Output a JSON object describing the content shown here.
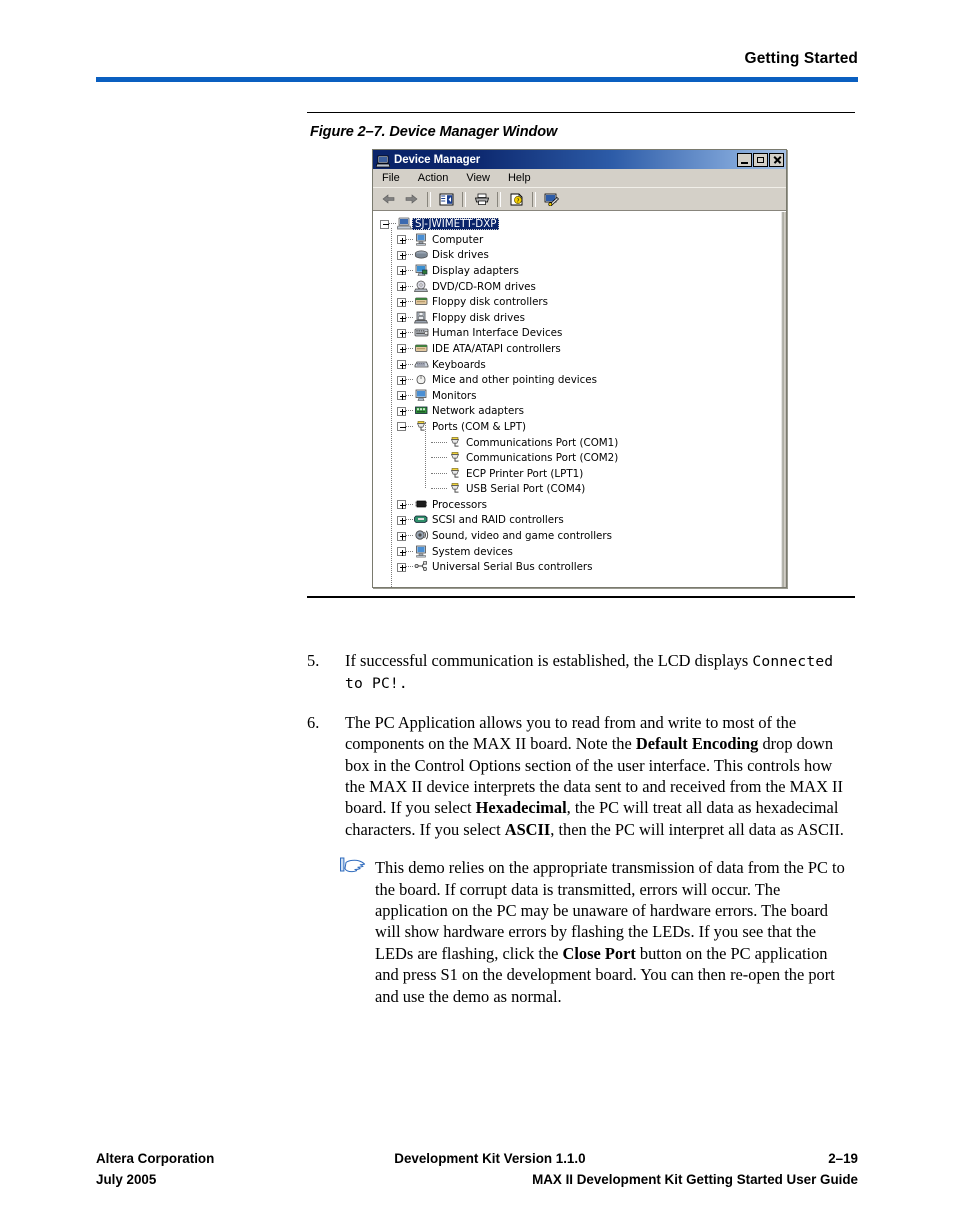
{
  "header": {
    "title": "Getting Started",
    "rule_color": "#0a5fc0"
  },
  "figure": {
    "caption": "Figure 2–7. Device Manager Window",
    "window": {
      "title": "Device Manager",
      "title_icon": "computer-icon",
      "window_controls": [
        {
          "name": "minimize",
          "label": "_"
        },
        {
          "name": "maximize",
          "label": "□"
        },
        {
          "name": "close",
          "label": "×"
        }
      ],
      "menus": [
        "File",
        "Action",
        "View",
        "Help"
      ],
      "toolbar": [
        {
          "name": "back-icon",
          "label": "Back"
        },
        {
          "name": "forward-icon",
          "label": "Forward"
        },
        {
          "name": "properties-icon",
          "label": "Properties"
        },
        {
          "name": "print-icon",
          "label": "Print"
        },
        {
          "name": "help-icon",
          "label": "Help"
        },
        {
          "name": "scan-hardware-icon",
          "label": "Scan for hardware changes"
        }
      ],
      "tree": {
        "root": {
          "label": "SJ-JWIMETT-DXP",
          "selected": true,
          "expanded": true,
          "icon": "computer-icon"
        },
        "items": [
          {
            "label": "Computer",
            "icon": "computer-icon",
            "state": "collapsed"
          },
          {
            "label": "Disk drives",
            "icon": "disk-drive-icon",
            "state": "collapsed"
          },
          {
            "label": "Display adapters",
            "icon": "display-adapter-icon",
            "state": "collapsed"
          },
          {
            "label": "DVD/CD-ROM drives",
            "icon": "cdrom-icon",
            "state": "collapsed"
          },
          {
            "label": "Floppy disk controllers",
            "icon": "controller-icon",
            "state": "collapsed"
          },
          {
            "label": "Floppy disk drives",
            "icon": "floppy-icon",
            "state": "collapsed"
          },
          {
            "label": "Human Interface Devices",
            "icon": "hid-icon",
            "state": "collapsed"
          },
          {
            "label": "IDE ATA/ATAPI controllers",
            "icon": "controller-icon",
            "state": "collapsed"
          },
          {
            "label": "Keyboards",
            "icon": "keyboard-icon",
            "state": "collapsed"
          },
          {
            "label": "Mice and other pointing devices",
            "icon": "mouse-icon",
            "state": "collapsed"
          },
          {
            "label": "Monitors",
            "icon": "monitor-icon",
            "state": "collapsed"
          },
          {
            "label": "Network adapters",
            "icon": "network-icon",
            "state": "collapsed"
          },
          {
            "label": "Ports (COM & LPT)",
            "icon": "port-icon",
            "state": "expanded"
          },
          {
            "label": "Processors",
            "icon": "processor-icon",
            "state": "collapsed"
          },
          {
            "label": "SCSI and RAID controllers",
            "icon": "scsi-icon",
            "state": "collapsed"
          },
          {
            "label": "Sound, video and game controllers",
            "icon": "sound-icon",
            "state": "collapsed"
          },
          {
            "label": "System devices",
            "icon": "system-device-icon",
            "state": "collapsed"
          },
          {
            "label": "Universal Serial Bus controllers",
            "icon": "usb-icon",
            "state": "collapsed"
          }
        ],
        "port_children": [
          {
            "label": "Communications Port (COM1)",
            "icon": "port-icon"
          },
          {
            "label": "Communications Port (COM2)",
            "icon": "port-icon"
          },
          {
            "label": "ECP Printer Port (LPT1)",
            "icon": "port-icon"
          },
          {
            "label": "USB Serial Port (COM4)",
            "icon": "port-icon"
          }
        ]
      }
    }
  },
  "content": {
    "step5": {
      "number": "5.",
      "text_before": "If successful communication is established, the LCD displays ",
      "code": "Connected to PC!",
      "text_after": "."
    },
    "step6": {
      "number": "6.",
      "p1": "The PC Application allows you to read from and write to most of the components on the MAX II board. Note the ",
      "b1": "Default Encoding",
      "p2": " drop down box in the Control Options section of the user interface. This controls how the MAX II device interprets the data sent to and received from the MAX II board. If you select ",
      "b2": "Hexadecimal",
      "p3": ", the PC will treat all data as hexadecimal characters. If you select ",
      "b3": "ASCII",
      "p4": ", then the PC will interpret all data as ASCII."
    },
    "note": {
      "icon": "pointing-hand-icon",
      "icon_color": "#3a7bd5",
      "p1": "This demo relies on the appropriate transmission of data from the PC to the board. If corrupt data is transmitted, errors will occur. The application on the PC may be unaware of hardware errors. The board will show hardware errors by flashing the LEDs. If you see that the LEDs are flashing, click the ",
      "b1": "Close Port",
      "p2": " button on the PC application and press S1 on the development board. You can then re-open the port and use the demo as normal."
    }
  },
  "footer": {
    "company": "Altera Corporation",
    "date": "July 2005",
    "version": "Development Kit Version 1.1.0",
    "page": "2–19",
    "guide": "MAX II Development Kit Getting Started User Guide"
  }
}
